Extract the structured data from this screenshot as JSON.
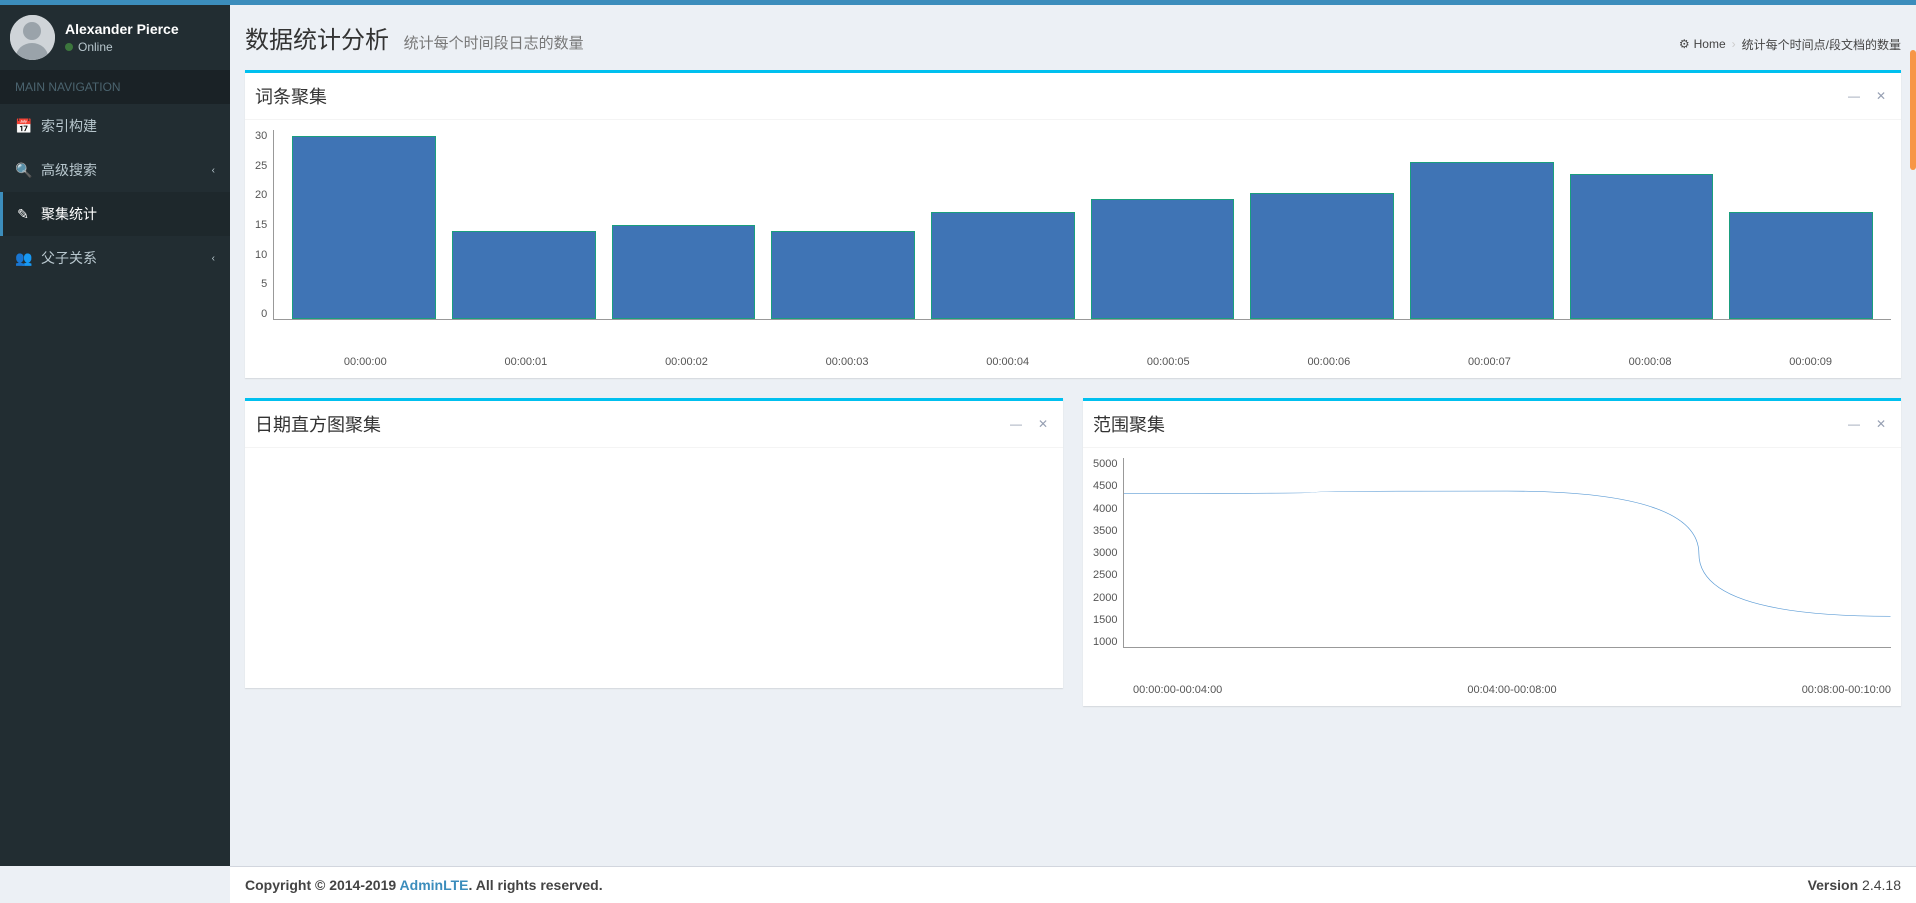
{
  "topbar_color": "#3c8dbc",
  "user": {
    "name": "Alexander Pierce",
    "status": "Online"
  },
  "sidebar": {
    "header": "MAIN NAVIGATION",
    "items": [
      {
        "label": "索引构建",
        "icon": "calendar",
        "expandable": false
      },
      {
        "label": "高级搜索",
        "icon": "search",
        "expandable": true
      },
      {
        "label": "聚集统计",
        "icon": "edit",
        "expandable": false,
        "active": true
      },
      {
        "label": "父子关系",
        "icon": "users",
        "expandable": true
      }
    ]
  },
  "header": {
    "title": "数据统计分析",
    "subtitle": "统计每个时间段日志的数量"
  },
  "breadcrumb": {
    "home": "Home",
    "current": "统计每个时间点/段文档的数量"
  },
  "boxes": {
    "box1_title": "词条聚集",
    "box2_title": "日期直方图聚集",
    "box3_title": "范围聚集"
  },
  "chart_data": [
    {
      "id": "terms_agg",
      "type": "bar",
      "title": "词条聚集",
      "categories": [
        "00:00:00",
        "00:00:01",
        "00:00:02",
        "00:00:03",
        "00:00:04",
        "00:00:05",
        "00:00:06",
        "00:00:07",
        "00:00:08",
        "00:00:09"
      ],
      "values": [
        29,
        14,
        15,
        14,
        17,
        19,
        20,
        25,
        23,
        17
      ],
      "ylim": [
        0,
        30
      ],
      "yticks": [
        0,
        5,
        10,
        15,
        20,
        25,
        30
      ],
      "xlabel": "",
      "ylabel": ""
    },
    {
      "id": "date_histogram",
      "type": "bar",
      "title": "日期直方图聚集",
      "categories": [],
      "values": [],
      "ylim": [
        0,
        0
      ],
      "note": "empty"
    },
    {
      "id": "range_agg",
      "type": "line",
      "title": "范围聚集",
      "categories": [
        "00:00:00-00:04:00",
        "00:04:00-00:08:00",
        "00:08:00-00:10:00"
      ],
      "values": [
        4250,
        4300,
        1650
      ],
      "ylim": [
        1000,
        5000
      ],
      "yticks": [
        1000,
        1500,
        2000,
        2500,
        3000,
        3500,
        4000,
        4500,
        5000
      ],
      "xlabel": "",
      "ylabel": ""
    }
  ],
  "footer": {
    "copyright_prefix": "Copyright © 2014-2019 ",
    "brand": "AdminLTE",
    "copyright_suffix": ". All rights reserved.",
    "version_label": "Version",
    "version": " 2.4.18"
  }
}
